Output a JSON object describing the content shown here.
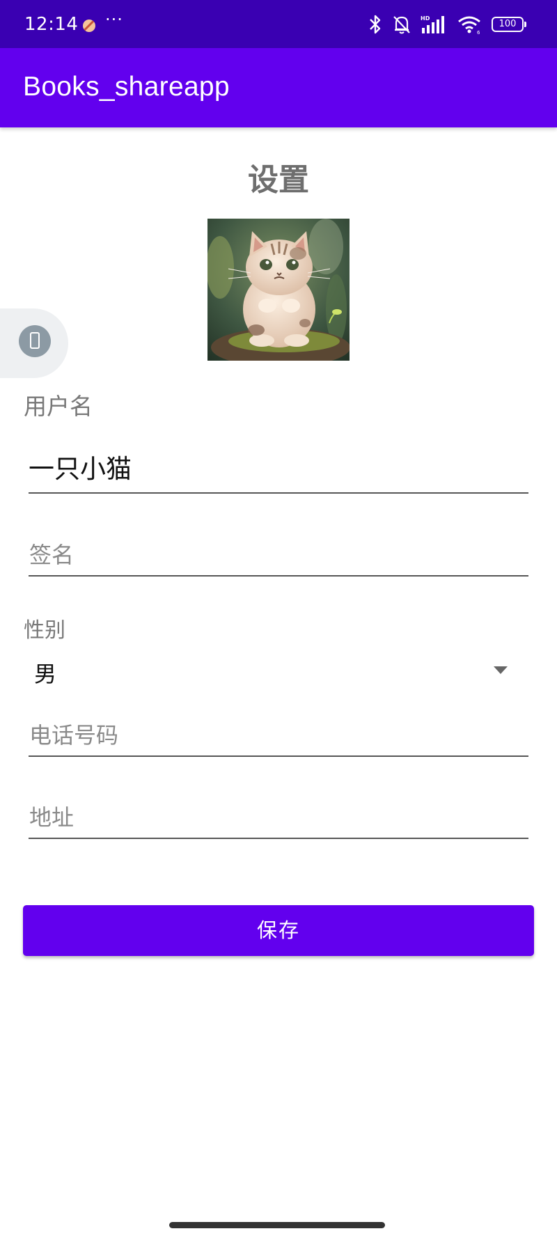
{
  "status_bar": {
    "time": "12:14",
    "more": "···",
    "battery": "100",
    "icons": [
      "bluetooth-icon",
      "bell-off-icon",
      "hd-signal-icon",
      "wifi-icon",
      "battery-icon"
    ]
  },
  "app_bar": {
    "title": "Books_shareapp",
    "background": "#6200ee"
  },
  "page": {
    "title": "设置"
  },
  "avatar": {
    "description_icon": "cat-avatar-image"
  },
  "form": {
    "username_label": "用户名",
    "username_value": "一只小猫",
    "signature_hint": "签名",
    "gender_label": "性别",
    "gender_value": "男",
    "phone_hint": "电话号码",
    "address_hint": "地址"
  },
  "actions": {
    "save_label": "保存"
  },
  "colors": {
    "status_bar": "#3a00b2",
    "accent": "#6200ee"
  }
}
